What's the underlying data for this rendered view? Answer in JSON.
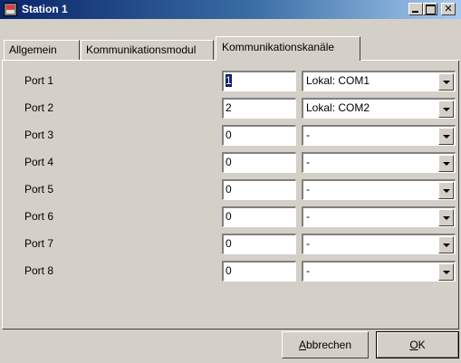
{
  "window": {
    "title": "Station 1"
  },
  "tabs": [
    {
      "label": "Allgemein"
    },
    {
      "label": "Kommunikationsmodul"
    },
    {
      "label": "Kommunikationskanäle",
      "selected": true
    }
  ],
  "ports": [
    {
      "label": "Port 1",
      "value": "1",
      "channel": "Lokal: COM1"
    },
    {
      "label": "Port 2",
      "value": "2",
      "channel": "Lokal: COM2"
    },
    {
      "label": "Port 3",
      "value": "0",
      "channel": "-"
    },
    {
      "label": "Port 4",
      "value": "0",
      "channel": "-"
    },
    {
      "label": "Port 5",
      "value": "0",
      "channel": "-"
    },
    {
      "label": "Port 6",
      "value": "0",
      "channel": "-"
    },
    {
      "label": "Port 7",
      "value": "0",
      "channel": "-"
    },
    {
      "label": "Port 8",
      "value": "0",
      "channel": "-"
    }
  ],
  "buttons": {
    "cancel": {
      "mnemonic": "A",
      "rest": "bbrechen"
    },
    "ok": {
      "mnemonic": "O",
      "rest": "K"
    }
  },
  "colors": {
    "titlebar_start": "#0a246a",
    "titlebar_end": "#a6caf0",
    "face": "#d4d0c8"
  },
  "icons": [
    "app-icon",
    "minimize-icon",
    "maximize-icon",
    "close-icon",
    "dropdown-arrow-icon"
  ]
}
